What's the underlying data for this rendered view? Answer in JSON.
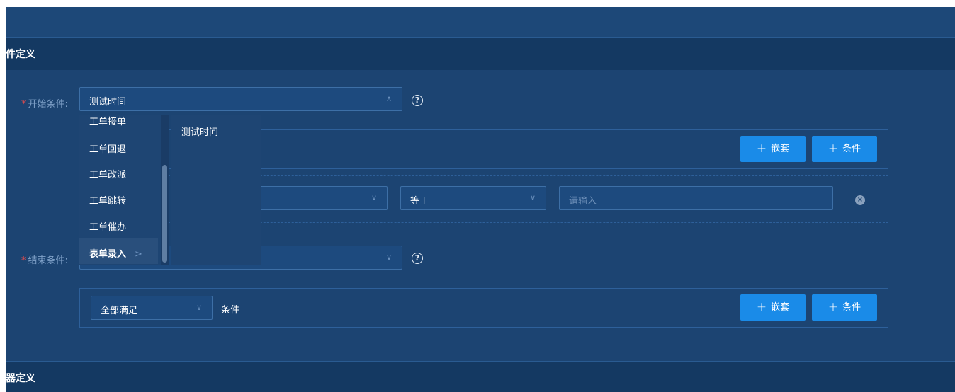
{
  "sections": {
    "event_title": "件定义",
    "task_title": "器定义"
  },
  "start": {
    "label": "开始条件:",
    "required": "*",
    "selected": "测试时间",
    "help": "?"
  },
  "end": {
    "label": "结束条件:",
    "required": "*",
    "help": "?"
  },
  "buttons": {
    "nest": "嵌套",
    "condition": "条件",
    "plus": "+"
  },
  "rule": {
    "operator": "等于",
    "value_placeholder": "请输入",
    "clear": "×"
  },
  "end_rule": {
    "match_mode": "全部满足",
    "suffix": "条件"
  },
  "dropdown": {
    "left_items": [
      "工单接单",
      "工单回退",
      "工单改派",
      "工单跳转",
      "工单催办",
      "表单录入"
    ],
    "active_chevron": ">",
    "right_items": [
      "测试时间"
    ]
  },
  "icons": {
    "arrow_up": "∧",
    "arrow_down": "∨"
  }
}
